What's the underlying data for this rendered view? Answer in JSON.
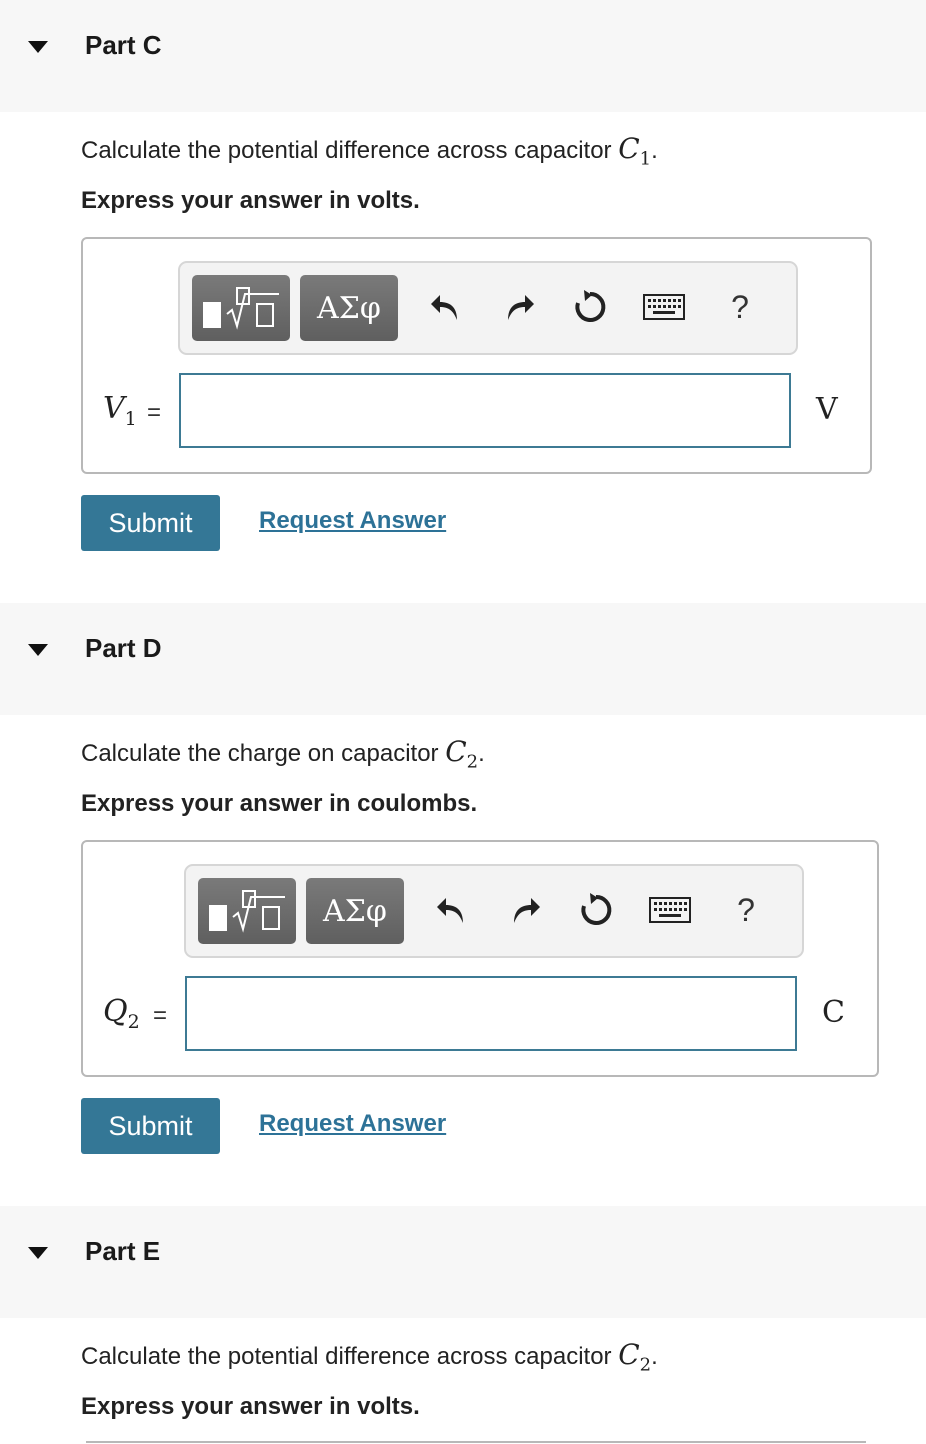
{
  "parts": [
    {
      "title": "Part C",
      "question_prefix": "Calculate the potential difference across capacitor",
      "question_var": "C",
      "question_sub": "1",
      "question_suffix": ".",
      "instruction": "Express your answer in volts.",
      "variable": "V",
      "variable_sub": "1",
      "equals": "=",
      "unit": "V",
      "input_value": "",
      "submit_label": "Submit",
      "request_label": "Request Answer"
    },
    {
      "title": "Part D",
      "question_prefix": "Calculate the charge on capacitor",
      "question_var": "C",
      "question_sub": "2",
      "question_suffix": ".",
      "instruction": "Express your answer in coulombs.",
      "variable": "Q",
      "variable_sub": "2",
      "equals": "=",
      "unit": "C",
      "input_value": "",
      "submit_label": "Submit",
      "request_label": "Request Answer"
    },
    {
      "title": "Part E",
      "question_prefix": "Calculate the potential difference across capacitor",
      "question_var": "C",
      "question_sub": "2",
      "question_suffix": ".",
      "instruction": "Express your answer in volts."
    }
  ],
  "toolbar": {
    "templates_icon": "templates-sqrt-icon",
    "greek_label": "ΑΣφ",
    "undo_icon": "undo-icon",
    "redo_icon": "redo-icon",
    "reset_icon": "reset-icon",
    "keyboard_icon": "keyboard-icon",
    "help_label": "?"
  },
  "colors": {
    "header_bg": "#f7f7f7",
    "submit_bg": "#347796",
    "link": "#2d7297",
    "input_border": "#3d7a94",
    "toolbar_button": "#6b6b6b"
  }
}
